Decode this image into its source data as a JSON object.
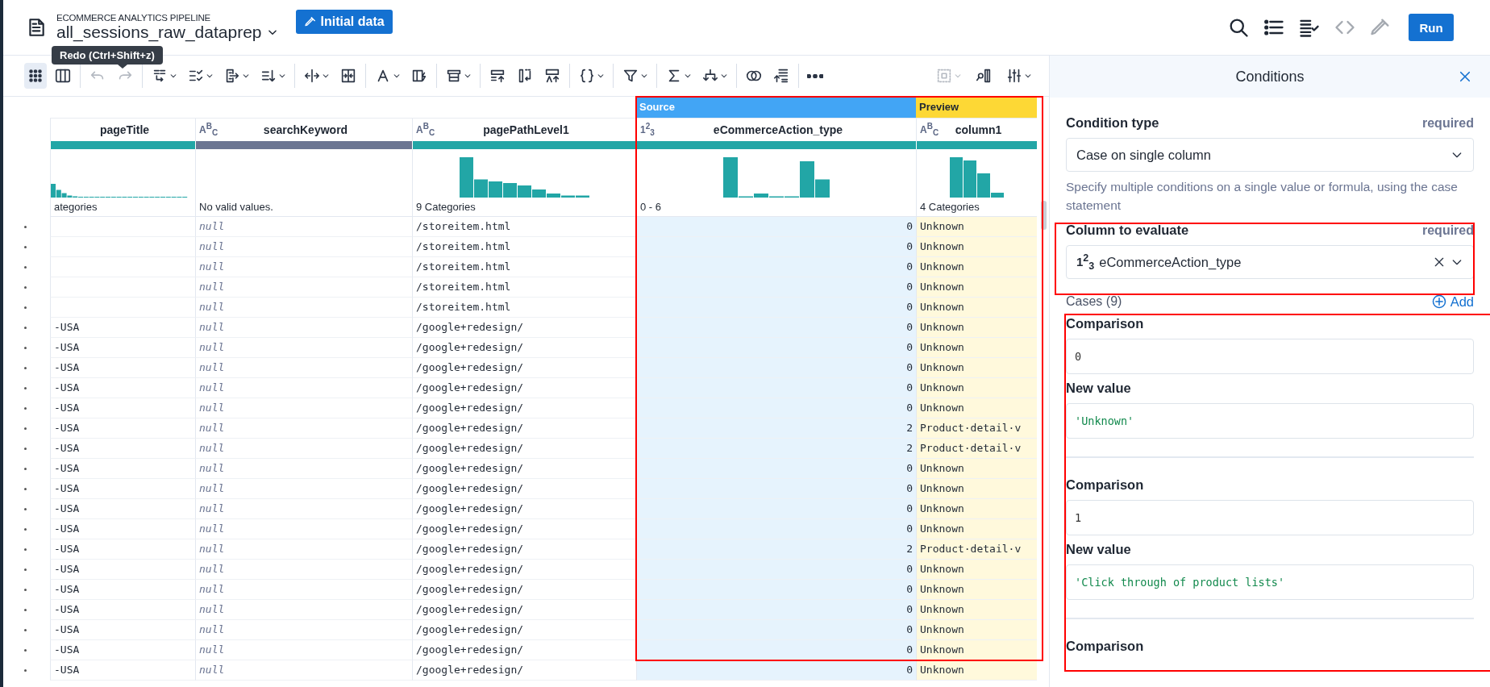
{
  "header": {
    "pipeline": "ECOMMERCE ANALYTICS PIPELINE",
    "title": "all_sessions_raw_dataprep",
    "initial_data_button": "Initial data",
    "tooltip": "Redo (Ctrl+Shift+z)",
    "tools": [
      {
        "kind": "search",
        "disabled": false
      },
      {
        "kind": "list",
        "disabled": false
      },
      {
        "kind": "list-check",
        "disabled": false
      },
      {
        "kind": "code",
        "disabled": true
      },
      {
        "kind": "eyedropper",
        "disabled": true
      }
    ],
    "run_button": "Run"
  },
  "toolbar": {
    "view_toggle": [
      {
        "kind": "grid",
        "selected": true
      },
      {
        "kind": "columns",
        "selected": false
      }
    ],
    "groups": [
      [
        {
          "kind": "undo",
          "disabled": true
        },
        {
          "kind": "redo",
          "disabled": true
        }
      ],
      [
        {
          "kind": "swap",
          "disabled": false
        },
        {
          "kind": "check-list",
          "disabled": false
        },
        {
          "kind": "export",
          "disabled": false
        },
        {
          "kind": "sort",
          "disabled": false
        }
      ],
      [
        {
          "kind": "split",
          "disabled": false
        },
        {
          "kind": "merge",
          "disabled": false
        }
      ],
      [
        {
          "kind": "text-style",
          "disabled": false
        },
        {
          "kind": "flash",
          "disabled": false
        }
      ],
      [
        {
          "kind": "rows",
          "disabled": false
        }
      ],
      [
        {
          "kind": "row-up",
          "disabled": false
        },
        {
          "kind": "column-return",
          "disabled": false
        },
        {
          "kind": "text-up",
          "disabled": false
        }
      ],
      [
        {
          "kind": "braces",
          "disabled": false
        }
      ],
      [
        {
          "kind": "filter",
          "disabled": false
        }
      ],
      [
        {
          "kind": "sigma",
          "disabled": false
        },
        {
          "kind": "branch",
          "disabled": false
        }
      ],
      [
        {
          "kind": "circles",
          "disabled": false
        },
        {
          "kind": "sort-lines",
          "disabled": false
        }
      ],
      [
        {
          "kind": "more",
          "disabled": false
        }
      ]
    ],
    "right": [
      {
        "kind": "select-box",
        "disabled": true
      },
      {
        "kind": "column-search",
        "disabled": false
      },
      {
        "kind": "sliders",
        "disabled": false
      }
    ]
  },
  "table": {
    "columns": [
      {
        "name": "pageTitle",
        "color": "#22a6a6",
        "summary": "ategories",
        "kind": "text"
      },
      {
        "name": "searchKeyword",
        "type_label": "A$^{B}$$_{C}$",
        "color": "#6b7592",
        "summary": "No valid values.",
        "kind": "text",
        "values_missing": true
      },
      {
        "name": "pagePathLevel1",
        "type_label": "A$^{B}$$_{C}$",
        "color": "#22a6a6",
        "summary": "9 Categories",
        "kind": "text"
      },
      {
        "name": "eCommerceAction_type",
        "type_label": "1$^{2}$$_{3}$",
        "color": "#22a6a6",
        "summary": "0 - 6",
        "kind": "number",
        "band": {
          "label": "Source",
          "kind": "source"
        }
      },
      {
        "name": "column1",
        "type_label": "A$^{B}$$_{C}$",
        "color": "#22a6a6",
        "summary": "4 Categories",
        "kind": "text",
        "band": {
          "label": "Preview",
          "kind": "preview"
        }
      }
    ],
    "rows": [
      [
        null,
        "null",
        "/storeitem.html",
        "0",
        "Unknown"
      ],
      [
        null,
        "null",
        "/storeitem.html",
        "0",
        "Unknown"
      ],
      [
        null,
        "null",
        "/storeitem.html",
        "0",
        "Unknown"
      ],
      [
        null,
        "null",
        "/storeitem.html",
        "0",
        "Unknown"
      ],
      [
        null,
        "null",
        "/storeitem.html",
        "0",
        "Unknown"
      ],
      [
        "-USA",
        "null",
        "/google+redesign/",
        "0",
        "Unknown"
      ],
      [
        "-USA",
        "null",
        "/google+redesign/",
        "0",
        "Unknown"
      ],
      [
        "-USA",
        "null",
        "/google+redesign/",
        "0",
        "Unknown"
      ],
      [
        "-USA",
        "null",
        "/google+redesign/",
        "0",
        "Unknown"
      ],
      [
        "-USA",
        "null",
        "/google+redesign/",
        "0",
        "Unknown"
      ],
      [
        "-USA",
        "null",
        "/google+redesign/",
        "2",
        "Product·detail·v"
      ],
      [
        "-USA",
        "null",
        "/google+redesign/",
        "2",
        "Product·detail·v"
      ],
      [
        "-USA",
        "null",
        "/google+redesign/",
        "0",
        "Unknown"
      ],
      [
        "-USA",
        "null",
        "/google+redesign/",
        "0",
        "Unknown"
      ],
      [
        "-USA",
        "null",
        "/google+redesign/",
        "0",
        "Unknown"
      ],
      [
        "-USA",
        "null",
        "/google+redesign/",
        "0",
        "Unknown"
      ],
      [
        "-USA",
        "null",
        "/google+redesign/",
        "2",
        "Product·detail·v"
      ],
      [
        "-USA",
        "null",
        "/google+redesign/",
        "0",
        "Unknown"
      ],
      [
        "-USA",
        "null",
        "/google+redesign/",
        "0",
        "Unknown"
      ],
      [
        "-USA",
        "null",
        "/google+redesign/",
        "0",
        "Unknown"
      ],
      [
        "-USA",
        "null",
        "/google+redesign/",
        "0",
        "Unknown"
      ],
      [
        "-USA",
        "null",
        "/google+redesign/",
        "0",
        "Unknown"
      ],
      [
        "-USA",
        "null",
        "/google+redesign/",
        "0",
        "Unknown"
      ]
    ]
  },
  "panel": {
    "title": "Conditions",
    "condition_type": {
      "label": "Condition type",
      "badge": "required",
      "value": "Case on single column",
      "help": "Specify multiple conditions on a single value or formula, using the case statement"
    },
    "column_to_evaluate": {
      "label": "Column to evaluate",
      "badge": "required",
      "type_label": "1$^{2}$$_{3}$",
      "value": "eCommerceAction_type"
    },
    "cases": {
      "title": "Cases (9)",
      "add": "Add",
      "items": [
        {
          "comparison_label": "Comparison",
          "comparison": "0",
          "new_value_label": "New value",
          "new_value": "'Unknown'"
        },
        {
          "comparison_label": "Comparison",
          "comparison": "1",
          "new_value_label": "New value",
          "new_value": "'Click through of product lists'"
        },
        {
          "comparison_label": "Comparison"
        }
      ]
    }
  },
  "annotation_boxes": [
    {
      "kind": "rectangle"
    },
    {
      "kind": "rectangle"
    },
    {
      "kind": "rectangle"
    }
  ]
}
